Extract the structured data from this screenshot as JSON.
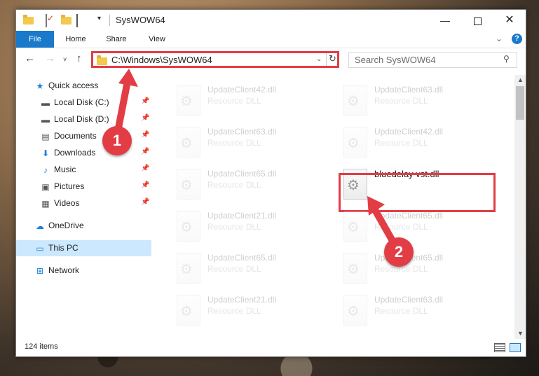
{
  "window": {
    "title": "SysWOW64",
    "minimize_glyph": "—",
    "close_glyph": "✕"
  },
  "ribbon": {
    "tabs": [
      "File",
      "Home",
      "Share",
      "View"
    ],
    "chevron": "⌄",
    "help": "?"
  },
  "nav": {
    "back": "←",
    "forward": "→",
    "recent": "˅",
    "up": "↑"
  },
  "address": {
    "path": "C:\\Windows\\SysWOW64",
    "dropdown": "⌄",
    "refresh": "↻"
  },
  "search": {
    "placeholder": "Search SysWOW64",
    "icon": "⚲"
  },
  "sidebar": {
    "items": [
      {
        "label": "Quick access",
        "icon": "★",
        "pinned": false
      },
      {
        "label": "Local Disk (C:)",
        "icon": "▬",
        "pinned": true
      },
      {
        "label": "Local Disk (D:)",
        "icon": "▬",
        "pinned": true
      },
      {
        "label": "Documents",
        "icon": "▤",
        "pinned": true
      },
      {
        "label": "Downloads",
        "icon": "⬇",
        "pinned": true
      },
      {
        "label": "Music",
        "icon": "♪",
        "pinned": true
      },
      {
        "label": "Pictures",
        "icon": "▣",
        "pinned": true
      },
      {
        "label": "Videos",
        "icon": "▦",
        "pinned": true
      },
      {
        "label": "OneDrive",
        "icon": "☁",
        "pinned": false
      },
      {
        "label": "This PC",
        "icon": "▭",
        "pinned": false
      },
      {
        "label": "Network",
        "icon": "⊞",
        "pinned": false
      }
    ],
    "pin_glyph": "📌"
  },
  "files": {
    "left": [
      {
        "name": "UpdateClient42.dll",
        "type": "Resource DLL"
      },
      {
        "name": "UpdateClient63.dll",
        "type": "Resource DLL"
      },
      {
        "name": "UpdateClient65.dll",
        "type": "Resource DLL"
      },
      {
        "name": "UpdateClient21.dll",
        "type": "Resource DLL"
      },
      {
        "name": "UpdateClient65.dll",
        "type": "Resource DLL"
      },
      {
        "name": "UpdateClient21.dll",
        "type": "Resource DLL"
      }
    ],
    "right": [
      {
        "name": "UpdateClient63.dll",
        "type": "Resource DLL"
      },
      {
        "name": "UpdateClient42.dll",
        "type": "Resource DLL"
      },
      {
        "name": "bluedelay vst.dll",
        "type": ""
      },
      {
        "name": "UpdateClient65.dll",
        "type": "Resource DLL"
      },
      {
        "name": "UpdateClient65.dll",
        "type": "Resource DLL"
      },
      {
        "name": "UpdateClient63.dll",
        "type": "Resource DLL"
      }
    ]
  },
  "status": {
    "count": "124 items"
  },
  "annotations": {
    "step1": "1",
    "step2": "2",
    "color": "#e23d45"
  },
  "colors": {
    "accent": "#1979ca",
    "selection": "#cce8ff"
  }
}
